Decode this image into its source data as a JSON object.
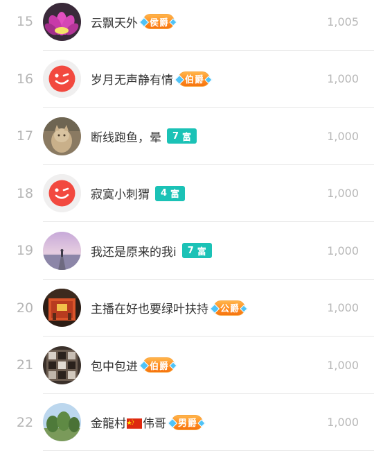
{
  "ranking": {
    "rows": [
      {
        "rank": "15",
        "name": "云飘天外",
        "name_after": "",
        "badge_type": "title",
        "badge": "侯爵",
        "badge_num": "",
        "value": "1,005",
        "avatar": "lotus-avatar"
      },
      {
        "rank": "16",
        "name": "岁月无声静有情",
        "name_after": "",
        "badge_type": "title",
        "badge": "伯爵",
        "badge_num": "",
        "value": "1,000",
        "avatar": "default-wink-avatar"
      },
      {
        "rank": "17",
        "name": "断线跑鱼，晕",
        "name_after": "",
        "badge_type": "rich",
        "badge": "富",
        "badge_num": "7",
        "value": "1,000",
        "avatar": "cat-avatar"
      },
      {
        "rank": "18",
        "name": "寂寞小刺猬",
        "name_after": "",
        "badge_type": "rich",
        "badge": "富",
        "badge_num": "4",
        "value": "1,000",
        "avatar": "default-wink-avatar"
      },
      {
        "rank": "19",
        "name": "我还是原来的我i",
        "name_after": "",
        "badge_type": "rich",
        "badge": "富",
        "badge_num": "7",
        "value": "1,000",
        "avatar": "sunset-pier-avatar"
      },
      {
        "rank": "20",
        "name": "主播在好也要绿叶扶持",
        "name_after": "",
        "badge_type": "title",
        "badge": "公爵",
        "badge_num": "",
        "value": "1,000",
        "avatar": "temple-avatar"
      },
      {
        "rank": "21",
        "name": "包中包进",
        "name_after": "",
        "badge_type": "title",
        "badge": "伯爵",
        "badge_num": "",
        "value": "1,000",
        "avatar": "shelf-avatar"
      },
      {
        "rank": "22",
        "name": "金龍村",
        "name_after": "伟哥",
        "badge_type": "title",
        "badge": "男爵",
        "badge_num": "",
        "value": "1,000",
        "avatar": "trees-avatar",
        "flag": "china-flag-icon"
      }
    ]
  },
  "colors": {
    "rank_text": "#b5b5b5",
    "name_text": "#333333",
    "value_text": "#b8b8b8",
    "title_badge": "#ff8a1e",
    "rich_badge": "#1bc2b6",
    "divider": "#e6e6e6"
  }
}
